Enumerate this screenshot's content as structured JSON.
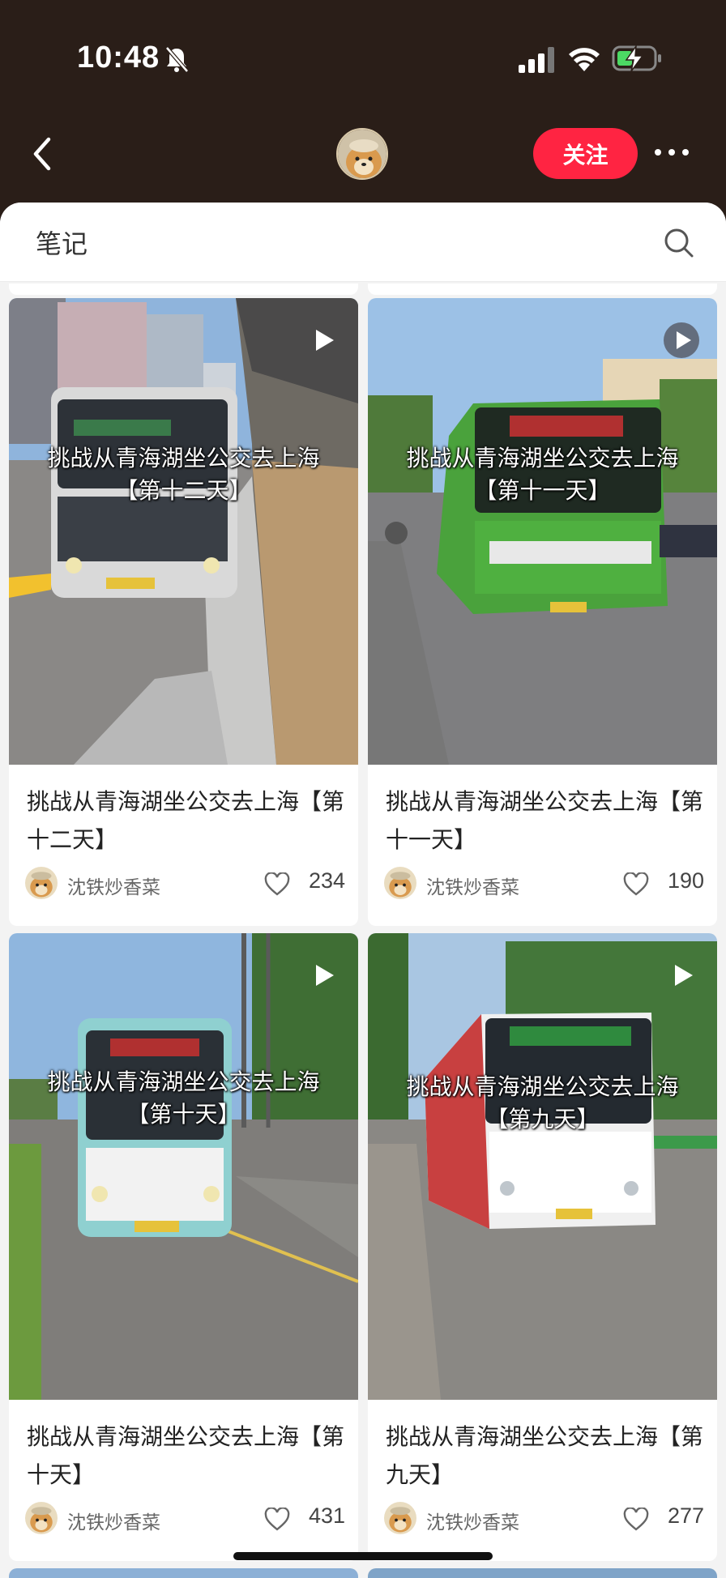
{
  "status_bar": {
    "time": "10:48"
  },
  "header": {
    "follow_label": "关注"
  },
  "sheet": {
    "title": "笔记"
  },
  "notes": [
    {
      "overlay_line1": "挑战从青海湖坐公交去上海",
      "overlay_line2": "【第十二天】",
      "title": "挑战从青海湖坐公交去上海【第十二天】",
      "author": "沈铁炒香菜",
      "likes": "234"
    },
    {
      "overlay_line1": "挑战从青海湖坐公交去上海",
      "overlay_line2": "【第十一天】",
      "title": "挑战从青海湖坐公交去上海【第十一天】",
      "author": "沈铁炒香菜",
      "likes": "190"
    },
    {
      "overlay_line1": "挑战从青海湖坐公交去上海",
      "overlay_line2": "【第十天】",
      "title": "挑战从青海湖坐公交去上海【第十天】",
      "author": "沈铁炒香菜",
      "likes": "431"
    },
    {
      "overlay_line1": "挑战从青海湖坐公交去上海",
      "overlay_line2": "【第九天】",
      "title": "挑战从青海湖坐公交去上海【第九天】",
      "author": "沈铁炒香菜",
      "likes": "277"
    }
  ],
  "colors": {
    "accent": "#ff2442",
    "header_bg": "#2a1e18"
  },
  "icons": [
    "mute-icon",
    "signal-icon",
    "wifi-icon",
    "battery-charging-icon",
    "back-icon",
    "more-icon",
    "search-icon",
    "play-icon",
    "heart-icon"
  ]
}
